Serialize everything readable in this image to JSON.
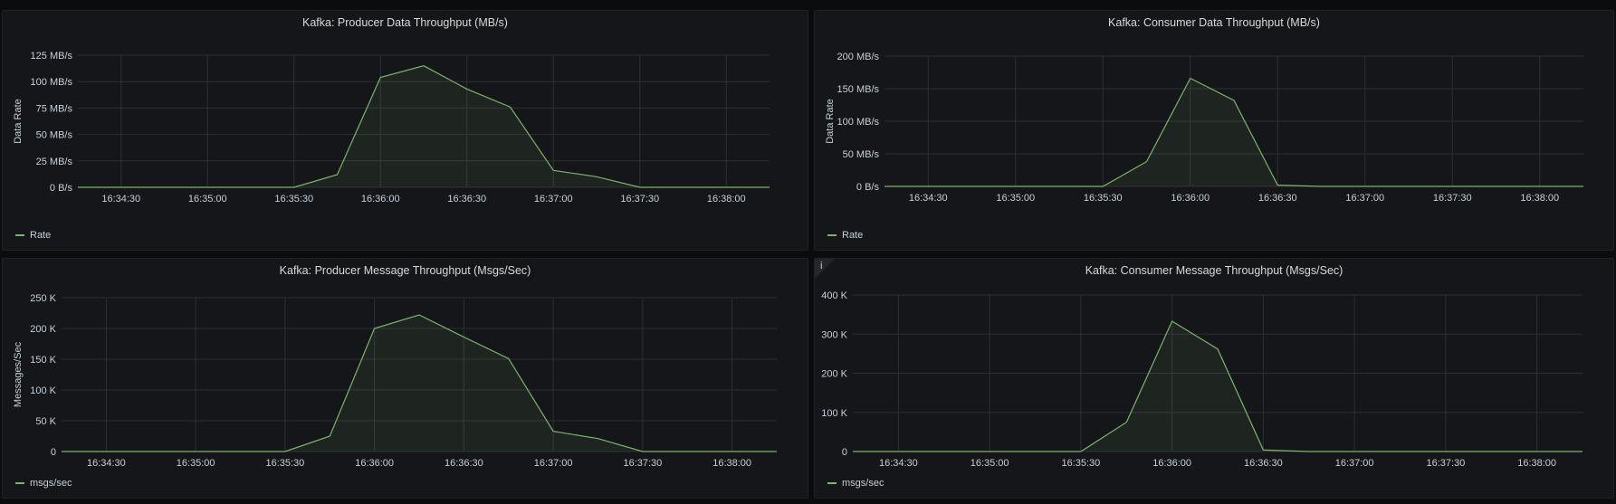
{
  "panels": [
    {
      "title": "Kafka: Producer Data Throughput (MB/s)",
      "ylabel": "Data Rate",
      "legend": "Rate",
      "info": false,
      "chart_data": {
        "type": "area",
        "title": "Kafka: Producer Data Throughput (MB/s)",
        "ylabel": "Data Rate",
        "xlim": [
          "16:34:15",
          "16:38:15"
        ],
        "ylim": [
          0,
          125
        ],
        "x_ticks": [
          "16:34:30",
          "16:35:00",
          "16:35:30",
          "16:36:00",
          "16:36:30",
          "16:37:00",
          "16:37:30",
          "16:38:00"
        ],
        "y_ticks": [
          "0 B/s",
          "25 MB/s",
          "50 MB/s",
          "75 MB/s",
          "100 MB/s",
          "125 MB/s"
        ],
        "series": [
          {
            "name": "Rate",
            "x": [
              "16:34:15",
              "16:34:30",
              "16:34:45",
              "16:35:00",
              "16:35:15",
              "16:35:30",
              "16:35:45",
              "16:36:00",
              "16:36:15",
              "16:36:30",
              "16:36:45",
              "16:37:00",
              "16:37:15",
              "16:37:30",
              "16:37:45",
              "16:38:00",
              "16:38:15"
            ],
            "values": [
              0,
              0,
              0,
              0,
              0,
              0,
              12,
              104,
              115,
              93,
              76,
              16,
              10,
              0,
              0,
              0,
              0
            ]
          }
        ]
      }
    },
    {
      "title": "Kafka: Consumer Data Throughput (MB/s)",
      "ylabel": "Data Rate",
      "legend": "Rate",
      "info": false,
      "chart_data": {
        "type": "area",
        "title": "Kafka: Consumer Data Throughput (MB/s)",
        "ylabel": "Data Rate",
        "xlim": [
          "16:34:15",
          "16:38:15"
        ],
        "ylim": [
          0,
          200
        ],
        "x_ticks": [
          "16:34:30",
          "16:35:00",
          "16:35:30",
          "16:36:00",
          "16:36:30",
          "16:37:00",
          "16:37:30",
          "16:38:00"
        ],
        "y_ticks": [
          "0 B/s",
          "50 MB/s",
          "100 MB/s",
          "150 MB/s",
          "200 MB/s"
        ],
        "series": [
          {
            "name": "Rate",
            "x": [
              "16:34:15",
              "16:34:30",
              "16:34:45",
              "16:35:00",
              "16:35:15",
              "16:35:30",
              "16:35:45",
              "16:36:00",
              "16:36:15",
              "16:36:30",
              "16:36:45",
              "16:37:00",
              "16:37:15",
              "16:37:30",
              "16:37:45",
              "16:38:00",
              "16:38:15"
            ],
            "values": [
              0,
              0,
              0,
              0,
              0,
              0,
              38,
              166,
              132,
              2,
              0,
              0,
              0,
              0,
              0,
              0,
              0
            ]
          }
        ]
      }
    },
    {
      "title": "Kafka: Producer Message Throughput (Msgs/Sec)",
      "ylabel": "Messages/Sec",
      "legend": "msgs/sec",
      "info": false,
      "chart_data": {
        "type": "area",
        "title": "Kafka: Producer Message Throughput (Msgs/Sec)",
        "ylabel": "Messages/Sec",
        "xlim": [
          "16:34:15",
          "16:38:15"
        ],
        "ylim": [
          0,
          250
        ],
        "x_ticks": [
          "16:34:30",
          "16:35:00",
          "16:35:30",
          "16:36:00",
          "16:36:30",
          "16:37:00",
          "16:37:30",
          "16:38:00"
        ],
        "y_ticks": [
          "0",
          "50 K",
          "100 K",
          "150 K",
          "200 K",
          "250 K"
        ],
        "series": [
          {
            "name": "msgs/sec",
            "x": [
              "16:34:15",
              "16:34:30",
              "16:34:45",
              "16:35:00",
              "16:35:15",
              "16:35:30",
              "16:35:45",
              "16:36:00",
              "16:36:15",
              "16:36:30",
              "16:36:45",
              "16:37:00",
              "16:37:15",
              "16:37:30",
              "16:37:45",
              "16:38:00",
              "16:38:15"
            ],
            "values": [
              0,
              0,
              0,
              0,
              0,
              0,
              25,
              200,
              222,
              186,
              151,
              33,
              21,
              0,
              0,
              0,
              0
            ]
          }
        ]
      }
    },
    {
      "title": "Kafka: Consumer Message Throughput (Msgs/Sec)",
      "ylabel": "",
      "legend": "msgs/sec",
      "info": true,
      "info_glyph": "i",
      "chart_data": {
        "type": "area",
        "title": "Kafka: Consumer Message Throughput (Msgs/Sec)",
        "ylabel": "",
        "xlim": [
          "16:34:15",
          "16:38:15"
        ],
        "ylim": [
          0,
          400
        ],
        "x_ticks": [
          "16:34:30",
          "16:35:00",
          "16:35:30",
          "16:36:00",
          "16:36:30",
          "16:37:00",
          "16:37:30",
          "16:38:00"
        ],
        "y_ticks": [
          "0",
          "100 K",
          "200 K",
          "300 K",
          "400 K"
        ],
        "series": [
          {
            "name": "msgs/sec",
            "x": [
              "16:34:15",
              "16:34:30",
              "16:34:45",
              "16:35:00",
              "16:35:15",
              "16:35:30",
              "16:35:45",
              "16:36:00",
              "16:36:15",
              "16:36:30",
              "16:36:45",
              "16:37:00",
              "16:37:15",
              "16:37:30",
              "16:37:45",
              "16:38:00",
              "16:38:15"
            ],
            "values": [
              0,
              0,
              0,
              0,
              0,
              0,
              75,
              333,
              262,
              4,
              0,
              0,
              0,
              0,
              0,
              0,
              0
            ]
          }
        ]
      }
    }
  ],
  "colors": {
    "series_line": "#7eb26d",
    "series_fill": "#7eb26d",
    "grid": "#2c2f33",
    "axis_text": "#c7d0d9",
    "panel_bg": "#141619"
  }
}
